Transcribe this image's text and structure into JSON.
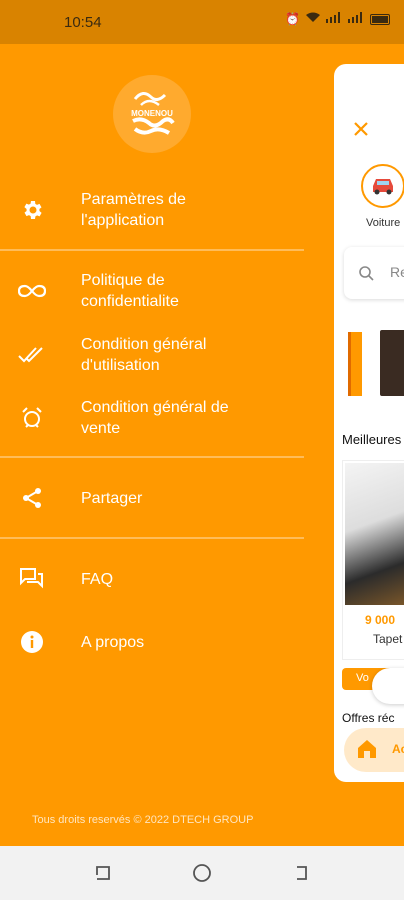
{
  "status_bar": {
    "time": "10:54"
  },
  "logo": {
    "text": "MONENOU"
  },
  "menu": [
    {
      "label": "Paramètres de\nl'application",
      "icon": "gear-icon"
    },
    {
      "label": "Politique de\nconfidentialite",
      "icon": "infinity-icon"
    },
    {
      "label": "Condition général\nd'utilisation",
      "icon": "double-check-icon"
    },
    {
      "label": "Condition général de\nvente",
      "icon": "alarm-icon"
    },
    {
      "label": "Partager",
      "icon": "share-icon"
    },
    {
      "label": "FAQ",
      "icon": "forum-icon"
    },
    {
      "label": "A propos",
      "icon": "info-icon"
    }
  ],
  "footer": {
    "copyright": "Tous droits reservés © 2022 DTECH GROUP"
  },
  "preview": {
    "category_label": "Voiture",
    "search_placeholder": "Re",
    "best_title": "Meilleures",
    "product_price": "9 000",
    "product_name": "Tapet",
    "voir_label": "Vo",
    "offres_title": "Offres réc",
    "nav_home_label": "Ac"
  },
  "colors": {
    "accent": "#FF9900",
    "status_bar": "#D98300"
  }
}
